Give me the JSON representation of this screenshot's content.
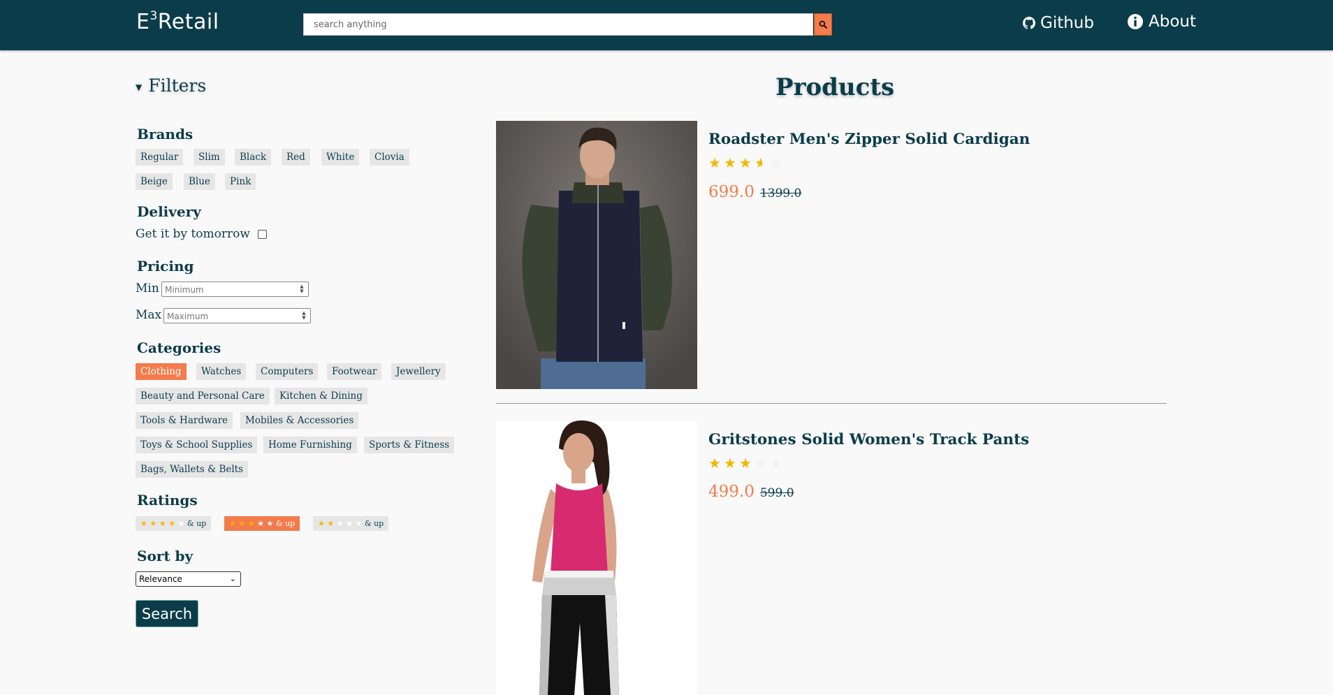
{
  "header": {
    "logo_main": "E",
    "logo_sup": "3",
    "logo_rest": "Retail",
    "search_placeholder": "search anything",
    "github_label": "Github",
    "about_label": "About"
  },
  "sidebar": {
    "filters_label": "Filters",
    "brands_title": "Brands",
    "brands": [
      "Regular",
      "Slim",
      "Black",
      "Red",
      "White",
      "Clovia",
      "Beige",
      "Blue",
      "Pink"
    ],
    "delivery_title": "Delivery",
    "delivery_label": "Get it by tomorrow",
    "delivery_checked": false,
    "pricing_title": "Pricing",
    "min_label": "Min",
    "min_placeholder": "Minimum",
    "max_label": "Max",
    "max_placeholder": "Maximum",
    "categories_title": "Categories",
    "categories": [
      "Clothing",
      "Watches",
      "Computers",
      "Footwear",
      "Jewellery",
      "Beauty and Personal Care",
      "Kitchen & Dining",
      "Tools & Hardware",
      "Mobiles & Accessories",
      "Toys & School Supplies",
      "Home Furnishing",
      "Sports & Fitness",
      "Bags, Wallets & Belts"
    ],
    "active_category": "Clothing",
    "ratings_title": "Ratings",
    "ratings": [
      {
        "stars": 4,
        "label": "& up",
        "active": false
      },
      {
        "stars": 3,
        "label": "& up",
        "active": true
      },
      {
        "stars": 2,
        "label": "& up",
        "active": false
      }
    ],
    "sort_title": "Sort by",
    "sort_value": "Relevance",
    "search_button": "Search"
  },
  "main": {
    "title": "Products",
    "products": [
      {
        "name": "Roadster Men's Zipper Solid Cardigan",
        "rating": 3.5,
        "price": "699.0",
        "mrp": "1399.0"
      },
      {
        "name": "Gritstones Solid Women's Track Pants",
        "rating": 3,
        "price": "499.0",
        "mrp": "599.0"
      }
    ]
  },
  "colors": {
    "brand": "#0b3c49",
    "accent": "#f47b4b",
    "star": "#f7b500",
    "chip": "#e6e6e6",
    "background": "#f9f9f9"
  },
  "icons": [
    "search-icon",
    "github-icon",
    "info-icon",
    "chevron-down-icon",
    "star-icon"
  ]
}
